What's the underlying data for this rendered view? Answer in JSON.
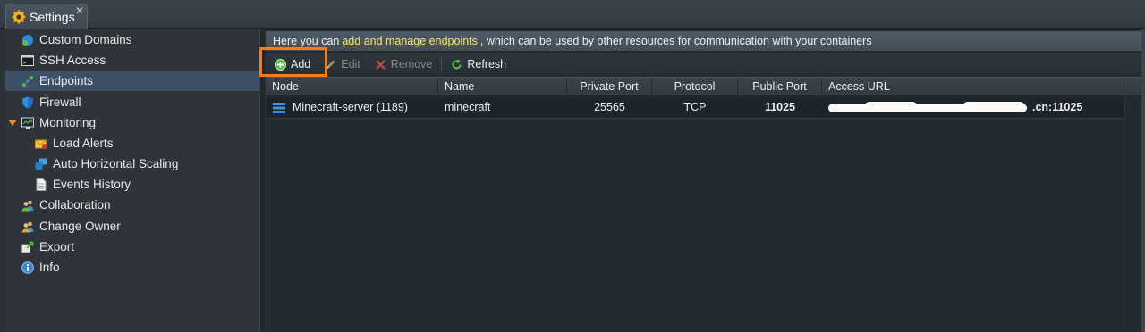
{
  "tab": {
    "title": "Settings",
    "close": "✕",
    "icon": "gear-icon"
  },
  "sidebar": {
    "items": [
      {
        "label": "Custom Domains",
        "icon": "custom-domains-icon"
      },
      {
        "label": "SSH Access",
        "icon": "terminal-icon"
      },
      {
        "label": "Endpoints",
        "icon": "endpoints-icon",
        "selected": true
      },
      {
        "label": "Firewall",
        "icon": "shield-icon"
      },
      {
        "label": "Monitoring",
        "icon": "monitor-icon",
        "expanded": true
      },
      {
        "label": "Load Alerts",
        "icon": "alert-mail-icon",
        "child": true
      },
      {
        "label": "Auto Horizontal Scaling",
        "icon": "scaling-icon",
        "child": true
      },
      {
        "label": "Events History",
        "icon": "document-icon",
        "child": true
      },
      {
        "label": "Collaboration",
        "icon": "users-icon"
      },
      {
        "label": "Change Owner",
        "icon": "change-owner-icon"
      },
      {
        "label": "Export",
        "icon": "export-icon"
      },
      {
        "label": "Info",
        "icon": "info-icon"
      }
    ]
  },
  "info": {
    "prefix": "Here you can",
    "link": "add and manage endpoints",
    "suffix": ", which can be used by other resources for communication with your containers"
  },
  "toolbar": {
    "add": "Add",
    "edit": "Edit",
    "remove": "Remove",
    "refresh": "Refresh"
  },
  "grid": {
    "columns": [
      "Node",
      "Name",
      "Private Port",
      "Protocol",
      "Public Port",
      "Access URL"
    ],
    "rows": [
      {
        "node": "Minecraft-server (1189)",
        "name": "minecraft",
        "private_port": "25565",
        "protocol": "TCP",
        "public_port": "11025",
        "access_url_visible": ".cn:11025"
      }
    ]
  },
  "colors": {
    "selected": "#3d5066",
    "highlight": "#ef7d22",
    "link": "#f2e86a",
    "accent_orange": "#e88e2b"
  }
}
